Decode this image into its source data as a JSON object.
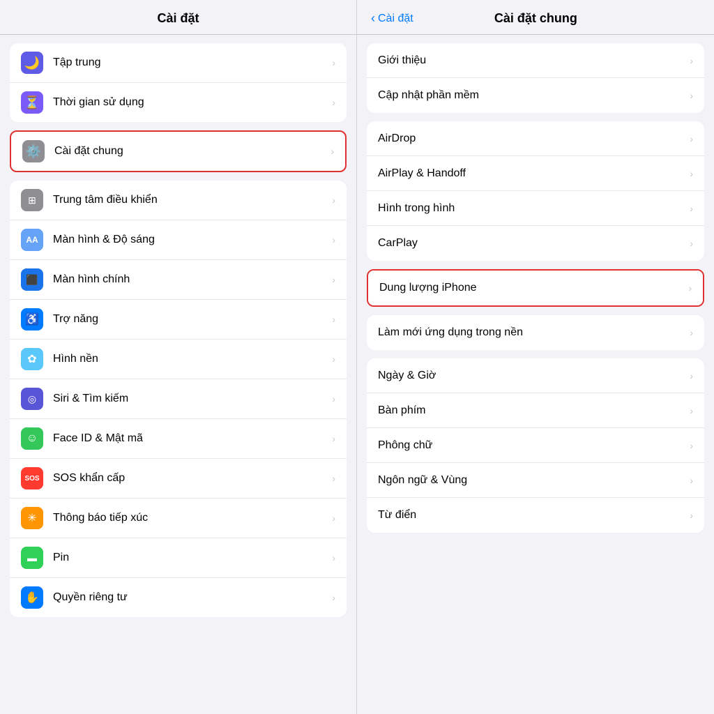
{
  "left": {
    "header": "Cài đặt",
    "items_group1": [
      {
        "id": "tap-trung",
        "label": "Tập trung",
        "icon": "🌙",
        "iconClass": "icon-purple"
      },
      {
        "id": "thoi-gian",
        "label": "Thời gian sử dụng",
        "icon": "⏳",
        "iconClass": "icon-purple2"
      }
    ],
    "items_group2_highlighted": [
      {
        "id": "cai-dat-chung",
        "label": "Cài đặt chung",
        "icon": "⚙️",
        "iconClass": "icon-gray",
        "highlighted": true
      }
    ],
    "items_group3": [
      {
        "id": "trung-tam",
        "label": "Trung tâm điều khiển",
        "icon": "⊞",
        "iconClass": "icon-gray"
      },
      {
        "id": "man-hinh-do-sang",
        "label": "Màn hình & Độ sáng",
        "icon": "AA",
        "iconClass": "icon-blue-light"
      },
      {
        "id": "man-hinh-chinh",
        "label": "Màn hình chính",
        "icon": "⬛",
        "iconClass": "icon-blue"
      },
      {
        "id": "tro-nang",
        "label": "Trợ năng",
        "icon": "♿",
        "iconClass": "icon-blue2"
      },
      {
        "id": "hinh-nen",
        "label": "Hình nền",
        "icon": "✿",
        "iconClass": "icon-teal"
      },
      {
        "id": "siri",
        "label": "Siri & Tìm kiếm",
        "icon": "◎",
        "iconClass": "icon-indigo"
      },
      {
        "id": "face-id",
        "label": "Face ID & Mật mã",
        "icon": "☺",
        "iconClass": "icon-green"
      },
      {
        "id": "sos",
        "label": "SOS khẩn cấp",
        "icon": "SOS",
        "iconClass": "icon-red"
      },
      {
        "id": "thong-bao",
        "label": "Thông báo tiếp xúc",
        "icon": "✳",
        "iconClass": "icon-orange"
      },
      {
        "id": "pin",
        "label": "Pin",
        "icon": "▬",
        "iconClass": "icon-green2"
      },
      {
        "id": "quyen-rieng",
        "label": "Quyền riêng tư",
        "icon": "✋",
        "iconClass": "icon-blue2"
      }
    ]
  },
  "right": {
    "back_label": "Cài đặt",
    "header": "Cài đặt chung",
    "group1": [
      {
        "id": "gioi-thieu",
        "label": "Giới thiệu"
      },
      {
        "id": "cap-nhat",
        "label": "Cập nhật phần mềm"
      }
    ],
    "group2": [
      {
        "id": "airdrop",
        "label": "AirDrop"
      },
      {
        "id": "airplay",
        "label": "AirPlay & Handoff"
      },
      {
        "id": "hinh-trong-hinh",
        "label": "Hình trong hình"
      },
      {
        "id": "carplay",
        "label": "CarPlay"
      }
    ],
    "highlighted": {
      "id": "dung-luong",
      "label": "Dung lượng iPhone"
    },
    "group3_single": [
      {
        "id": "lam-moi",
        "label": "Làm mới ứng dụng trong nền"
      }
    ],
    "group4": [
      {
        "id": "ngay-gio",
        "label": "Ngày & Giờ"
      },
      {
        "id": "ban-phim",
        "label": "Bàn phím"
      },
      {
        "id": "phong-chu",
        "label": "Phông chữ"
      },
      {
        "id": "ngon-ngu",
        "label": "Ngôn ngữ & Vùng"
      },
      {
        "id": "tu-dien",
        "label": "Từ điển"
      }
    ]
  },
  "icons": {
    "chevron": "›",
    "back_chevron": "‹"
  }
}
